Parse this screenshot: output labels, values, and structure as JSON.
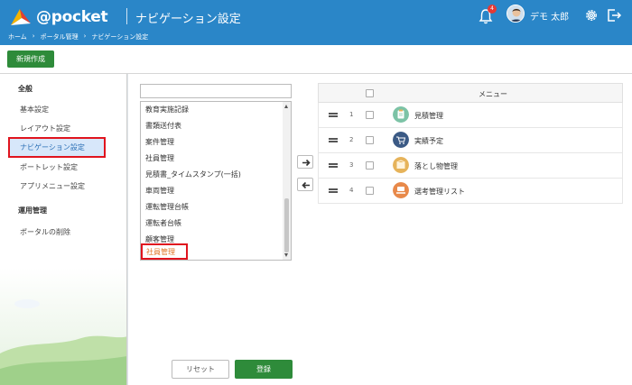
{
  "header": {
    "brand": "@pocket",
    "page_title": "ナビゲーション設定",
    "notification_count": "4",
    "user_name": "デモ 太郎",
    "breadcrumb": [
      "ホーム",
      "›",
      "ポータル管理",
      "›",
      "ナビゲーション設定"
    ],
    "accent_color": "#2a86c8"
  },
  "toolbar": {
    "new_label": "新規作成"
  },
  "sidebar": {
    "section_general": "全般",
    "items_general": [
      "基本設定",
      "レイアウト設定",
      "ナビゲーション設定",
      "ポートレット設定",
      "アプリメニュー設定"
    ],
    "active_index": 2,
    "section_ops": "運用管理",
    "items_ops": [
      "ポータルの削除"
    ]
  },
  "available_list": {
    "search_value": "",
    "items": [
      "教育実施記録",
      "書類送付表",
      "案件管理",
      "社員管理",
      "見積書_タイムスタンプ(一括)",
      "車両管理",
      "運転管理台帳",
      "運転者台帳",
      "顧客管理",
      "社員管理"
    ],
    "highlighted_index": 9
  },
  "menu": {
    "header_label": "メニュー",
    "rows": [
      {
        "num": "1",
        "label": "見積管理",
        "icon": "clipboard-icon",
        "color": "#7cc3a6"
      },
      {
        "num": "2",
        "label": "実績予定",
        "icon": "cart-icon",
        "color": "#3b5a85"
      },
      {
        "num": "3",
        "label": "落とし物管理",
        "icon": "box-icon",
        "color": "#e6b35a"
      },
      {
        "num": "4",
        "label": "選考管理リスト",
        "icon": "hand-icon",
        "color": "#e8894a"
      }
    ]
  },
  "buttons": {
    "reset_label": "リセット",
    "save_label": "登録"
  }
}
